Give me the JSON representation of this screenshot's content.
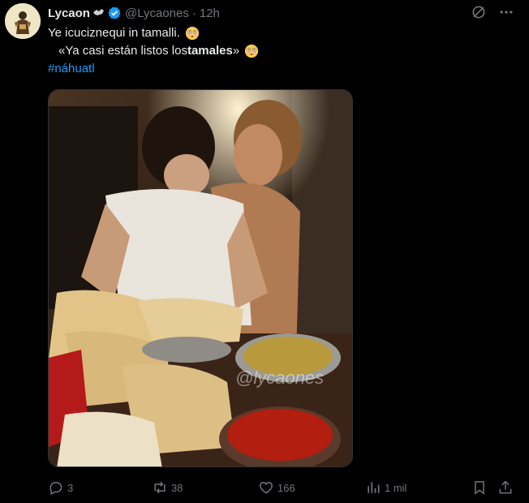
{
  "tweet": {
    "author": {
      "name": "Lycaon",
      "handle": "@Lycaones",
      "time": "12h",
      "separator": "·"
    },
    "text": {
      "line1": "Ye icuciznequi in tamalli.",
      "line2_prefix": "«Ya casi están listos los ",
      "line2_bold": "tamales",
      "line2_suffix": "»",
      "hashtag": "#náhuatl"
    },
    "media": {
      "watermark": "@lycaones"
    },
    "actions": {
      "replies": "3",
      "reposts": "38",
      "likes": "166",
      "views": "1 mil"
    }
  },
  "icons": {
    "affiliation": "wolf-icon",
    "verified": "verified-badge-icon",
    "grok": "grok-icon",
    "more": "more-icon",
    "reply": "reply-icon",
    "repost": "repost-icon",
    "like": "heart-icon",
    "views": "views-icon",
    "bookmark": "bookmark-icon",
    "share": "share-icon"
  },
  "colors": {
    "background": "#000000",
    "text": "#e7e9ea",
    "muted": "#71767b",
    "link": "#1d9bf0"
  }
}
